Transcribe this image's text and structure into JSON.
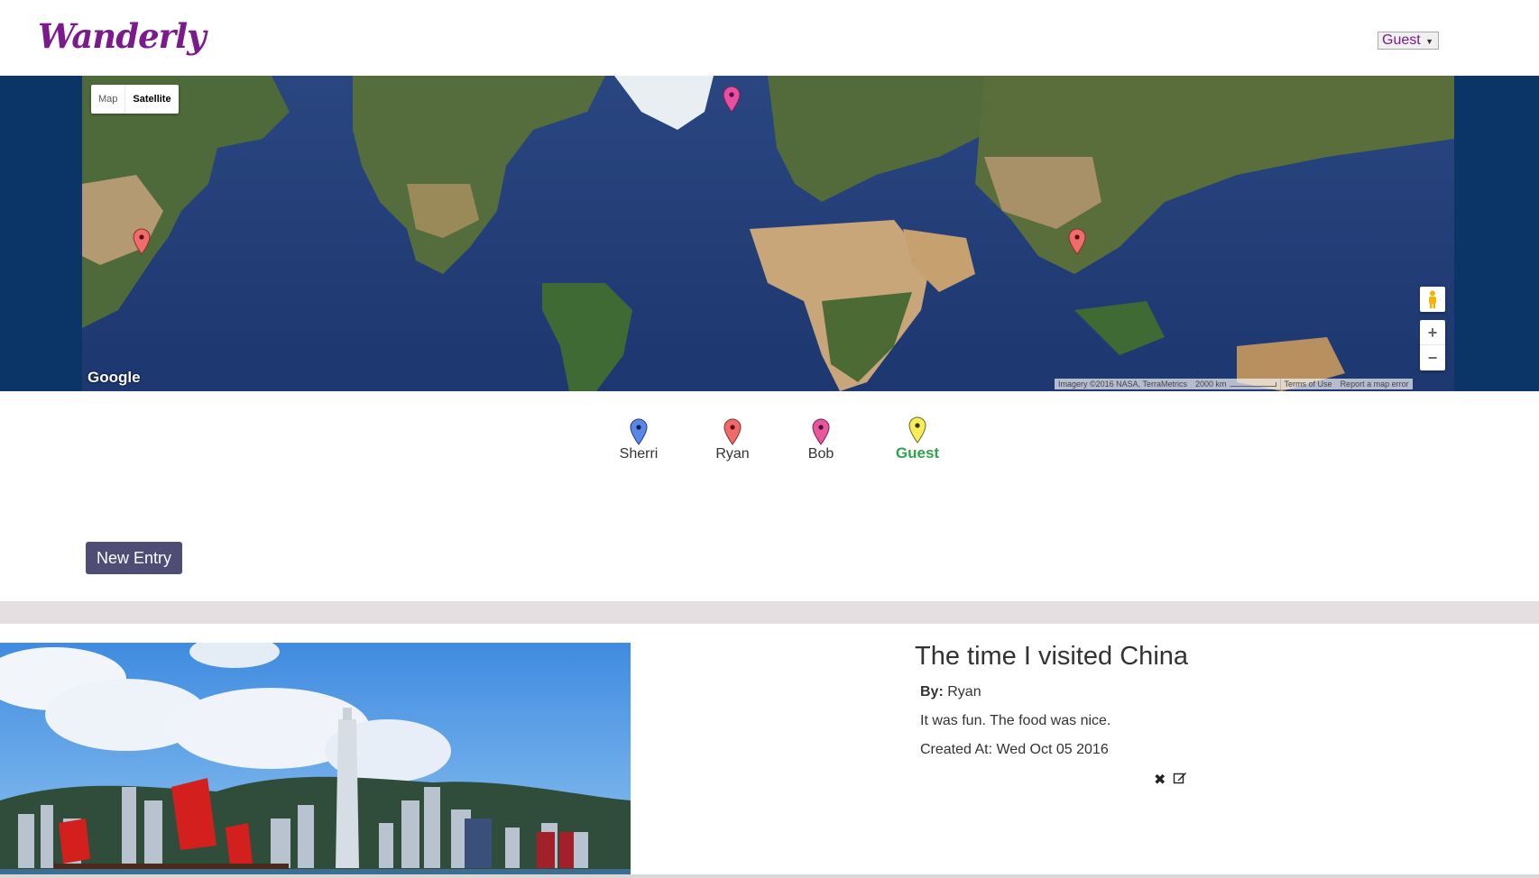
{
  "header": {
    "brand": "Wanderly",
    "user_select": {
      "selected": "Guest"
    }
  },
  "map": {
    "type_control": {
      "map_label": "Map",
      "satellite_label": "Satellite",
      "active": "Satellite"
    },
    "logo_text": "Google",
    "attribution": {
      "imagery": "Imagery ©2016 NASA, TerraMetrics",
      "scale": "2000 km",
      "terms": "Terms of Use",
      "report": "Report a map error"
    },
    "zoom_in_label": "+",
    "zoom_out_label": "−",
    "markers": [
      {
        "color": "#ee6c6c",
        "owner": "Ryan"
      },
      {
        "color": "#e84fa0",
        "owner": "Bob"
      },
      {
        "color": "#ee6c6c",
        "owner": "Ryan"
      }
    ]
  },
  "legend": {
    "items": [
      {
        "name": "Sherri",
        "color": "#5a86e8",
        "active": false
      },
      {
        "name": "Ryan",
        "color": "#ef6b6b",
        "active": false
      },
      {
        "name": "Bob",
        "color": "#e8579e",
        "active": false
      },
      {
        "name": "Guest",
        "color": "#f5ee5a",
        "active": true
      }
    ]
  },
  "actions": {
    "new_entry_label": "New Entry"
  },
  "entry": {
    "title": "The time I visited China",
    "by_label": "By:",
    "by_value": "Ryan",
    "body": "It was fun. The food was nice.",
    "created": "Created At: Wed Oct 05 2016",
    "delete_icon": "close-icon",
    "edit_icon": "edit-icon"
  }
}
